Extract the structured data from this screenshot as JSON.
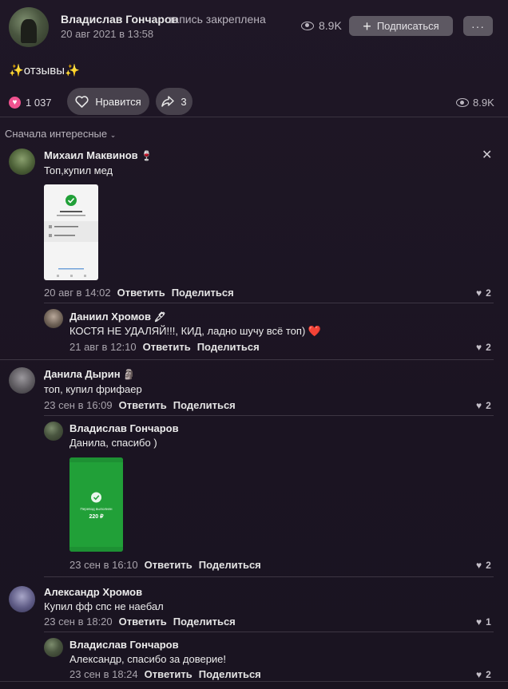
{
  "post": {
    "author": "Владислав Гончаров",
    "pinned_label": "запись закреплена",
    "date": "20 авг 2021 в 13:58",
    "views": "8.9K",
    "subscribe_label": "Подписаться",
    "more_label": "···",
    "text": "отзывы",
    "sparkle": "✨",
    "likes_count": "1 037",
    "like_label": "Нравится",
    "shares_count": "3",
    "views_bottom": "8.9K"
  },
  "sort_label": "Сначала интересные",
  "close_glyph": "✕",
  "comments": [
    {
      "name": "Михаил Маквинов",
      "emoji": "🍷",
      "text": "Топ,купил мед",
      "date": "20 авг в 14:02",
      "reply": "Ответить",
      "share": "Поделиться",
      "likes": "2"
    },
    {
      "name": "Даниил Хромов",
      "emoji": "🖋",
      "text": "КОСТЯ НЕ УДАЛЯЙ!!!, КИД, ладно шучу всё топ)",
      "text_emoji": "❤️",
      "date": "21 авг в 12:10",
      "reply": "Ответить",
      "share": "Поделиться",
      "likes": "2"
    },
    {
      "name": "Данила Дырин",
      "emoji": "🗿",
      "text": "топ, купил фрифаер",
      "date": "23 сен в 16:09",
      "reply": "Ответить",
      "share": "Поделиться",
      "likes": "2"
    },
    {
      "name": "Владислав Гончаров",
      "text": "Данила, спасибо )",
      "date": "23 сен в 16:10",
      "reply": "Ответить",
      "share": "Поделиться",
      "likes": "2"
    },
    {
      "name": "Александр Хромов",
      "text": "Купил фф спс не наебал",
      "date": "23 сен в 18:20",
      "reply": "Ответить",
      "share": "Поделиться",
      "likes": "1"
    },
    {
      "name": "Владислав Гончаров",
      "text": "Александр, спасибо за доверие!",
      "date": "23 сен в 18:24",
      "reply": "Ответить",
      "share": "Поделиться",
      "likes": "2"
    }
  ],
  "screenshot1": {
    "title": "Платеж отправлен",
    "sub": "205 ₽ · Перевод по карте",
    "row1": "Сохранить в Избранное",
    "row2": "Получить квитанцию",
    "footer": "На главный экран"
  },
  "screenshot2": {
    "title": "Перевод выполнен",
    "amount": "220 ₽"
  },
  "colors": {
    "background": "#1c1523",
    "accent_pink": "#f0528f",
    "button_bg": "#5d5862",
    "success_green": "#21a038"
  }
}
